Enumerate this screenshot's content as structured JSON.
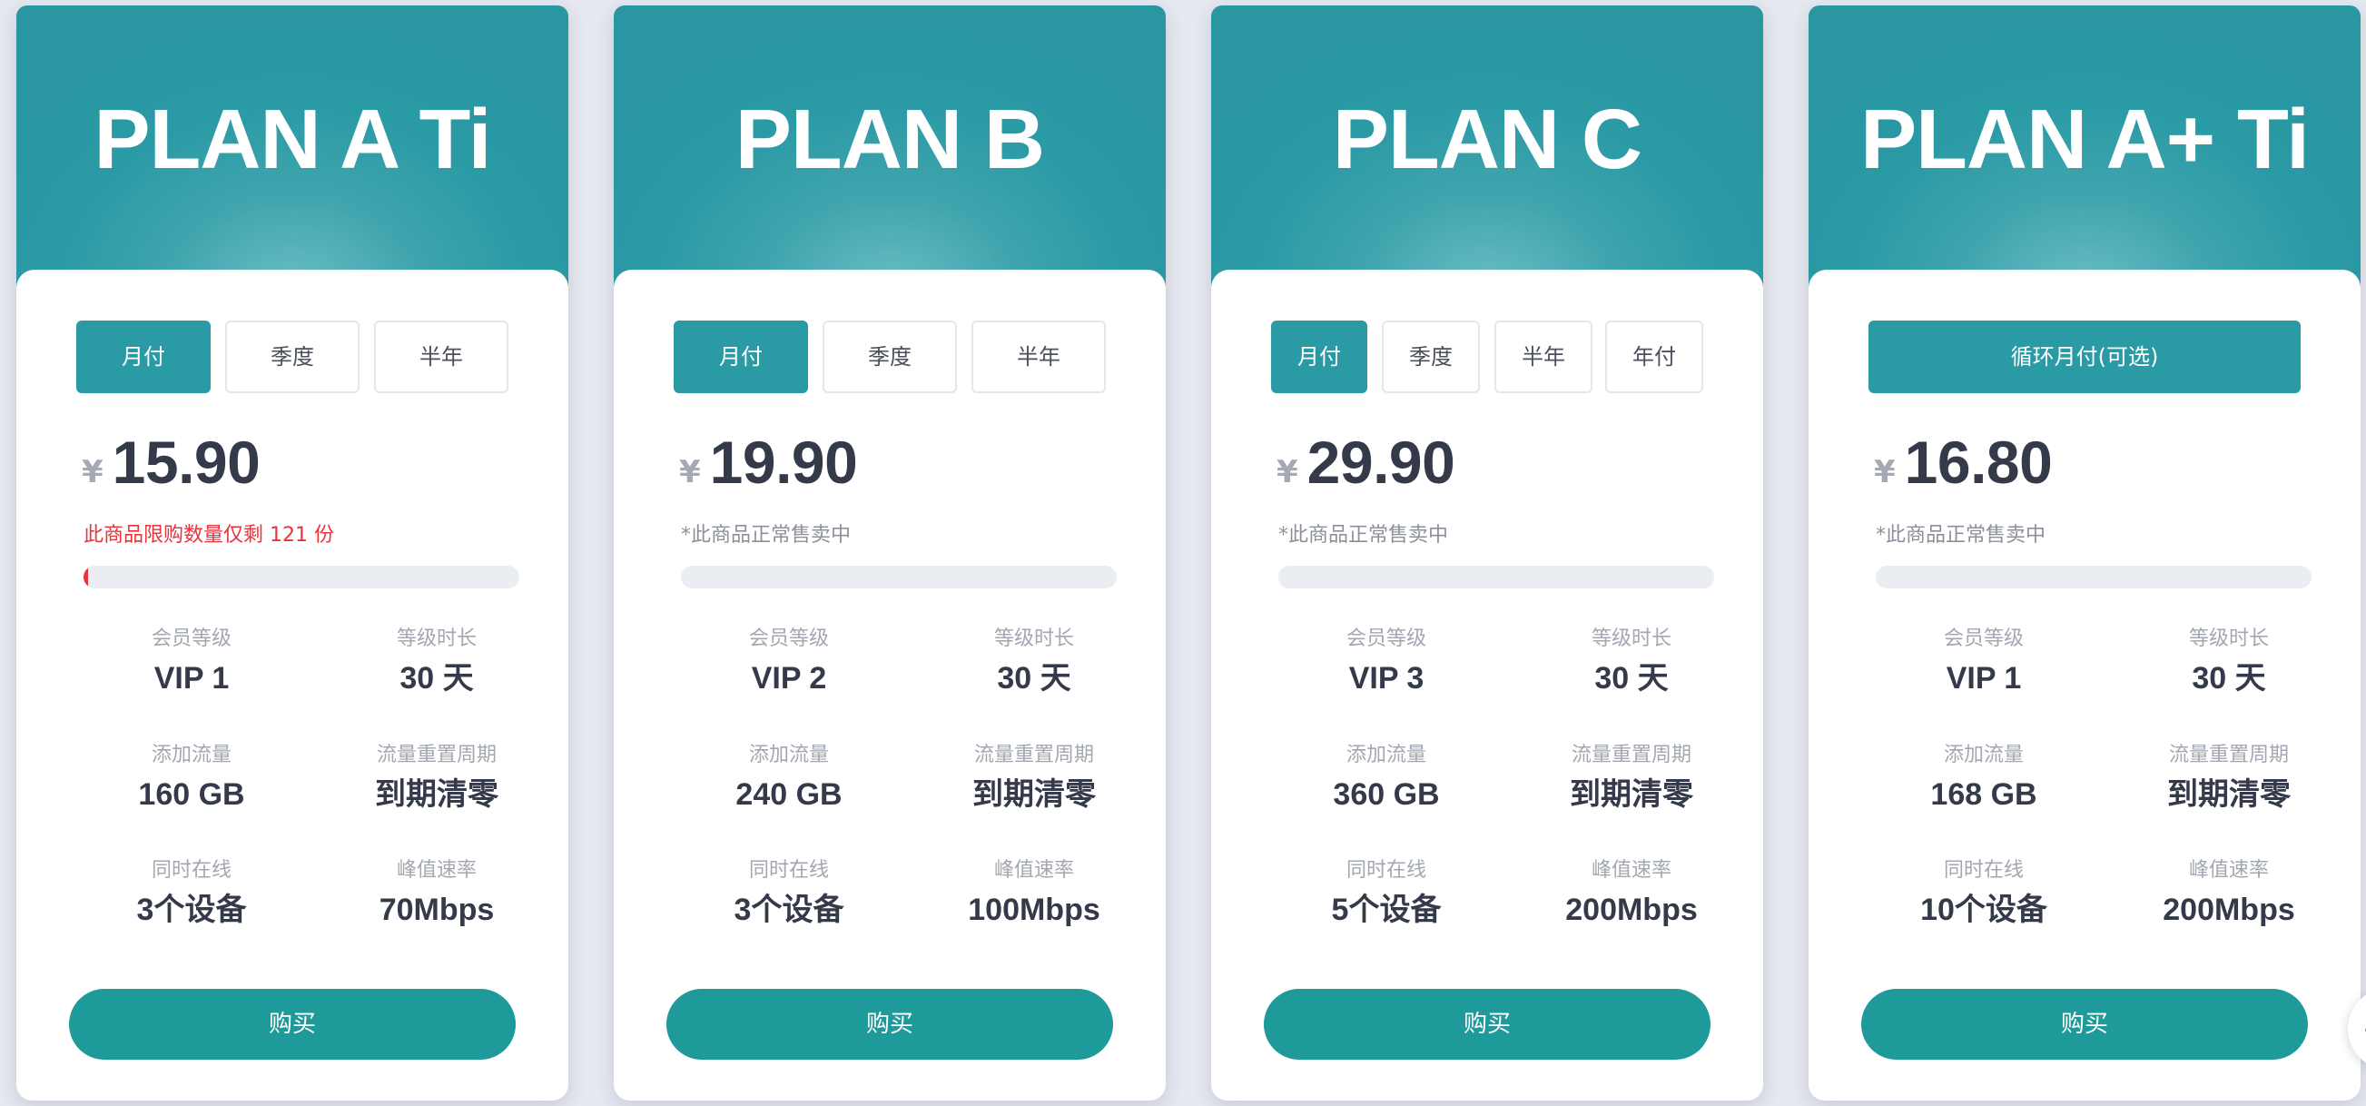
{
  "plans": [
    {
      "title": "PLAN A Ti",
      "periods": [
        "月付",
        "季度",
        "半年"
      ],
      "active_period": "月付",
      "currency": "¥",
      "price": "15.90",
      "stock_note": "此商品限购数量仅剩 121 份",
      "stock_warning": true,
      "stock_progress_fraction": 0.01,
      "specs": [
        {
          "label": "会员等级",
          "value": "VIP 1"
        },
        {
          "label": "等级时长",
          "value": "30 天"
        },
        {
          "label": "添加流量",
          "value": "160 GB"
        },
        {
          "label": "流量重置周期",
          "value": "到期清零"
        },
        {
          "label": "同时在线",
          "value": "3个设备"
        },
        {
          "label": "峰值速率",
          "value": "70Mbps"
        }
      ],
      "buy_label": "购买"
    },
    {
      "title": "PLAN B",
      "periods": [
        "月付",
        "季度",
        "半年"
      ],
      "active_period": "月付",
      "currency": "¥",
      "price": "19.90",
      "stock_note": "*此商品正常售卖中",
      "stock_warning": false,
      "stock_progress_fraction": 0,
      "specs": [
        {
          "label": "会员等级",
          "value": "VIP 2"
        },
        {
          "label": "等级时长",
          "value": "30 天"
        },
        {
          "label": "添加流量",
          "value": "240 GB"
        },
        {
          "label": "流量重置周期",
          "value": "到期清零"
        },
        {
          "label": "同时在线",
          "value": "3个设备"
        },
        {
          "label": "峰值速率",
          "value": "100Mbps"
        }
      ],
      "buy_label": "购买"
    },
    {
      "title": "PLAN C",
      "periods": [
        "月付",
        "季度",
        "半年",
        "年付"
      ],
      "active_period": "月付",
      "currency": "¥",
      "price": "29.90",
      "stock_note": "*此商品正常售卖中",
      "stock_warning": false,
      "stock_progress_fraction": 0,
      "specs": [
        {
          "label": "会员等级",
          "value": "VIP 3"
        },
        {
          "label": "等级时长",
          "value": "30 天"
        },
        {
          "label": "添加流量",
          "value": "360 GB"
        },
        {
          "label": "流量重置周期",
          "value": "到期清零"
        },
        {
          "label": "同时在线",
          "value": "5个设备"
        },
        {
          "label": "峰值速率",
          "value": "200Mbps"
        }
      ],
      "buy_label": "购买"
    },
    {
      "title": "PLAN A+ Ti",
      "periods": [
        "循环月付(可选)"
      ],
      "active_period": "循环月付(可选)",
      "currency": "¥",
      "price": "16.80",
      "stock_note": "*此商品正常售卖中",
      "stock_warning": false,
      "stock_progress_fraction": 0,
      "specs": [
        {
          "label": "会员等级",
          "value": "VIP 1"
        },
        {
          "label": "等级时长",
          "value": "30 天"
        },
        {
          "label": "添加流量",
          "value": "168 GB"
        },
        {
          "label": "流量重置周期",
          "value": "到期清零"
        },
        {
          "label": "同时在线",
          "value": "10个设备"
        },
        {
          "label": "峰值速率",
          "value": "200Mbps"
        }
      ],
      "buy_label": "购买"
    }
  ],
  "edge_widget": {
    "glyph": "4"
  },
  "colors": {
    "accent": "#2a9aa5",
    "buy_button": "#1f9a9b",
    "warning": "#e8343c",
    "price_text": "#343a4a",
    "muted_text": "#a2a7b1",
    "page_background": "#e7e9f1"
  }
}
